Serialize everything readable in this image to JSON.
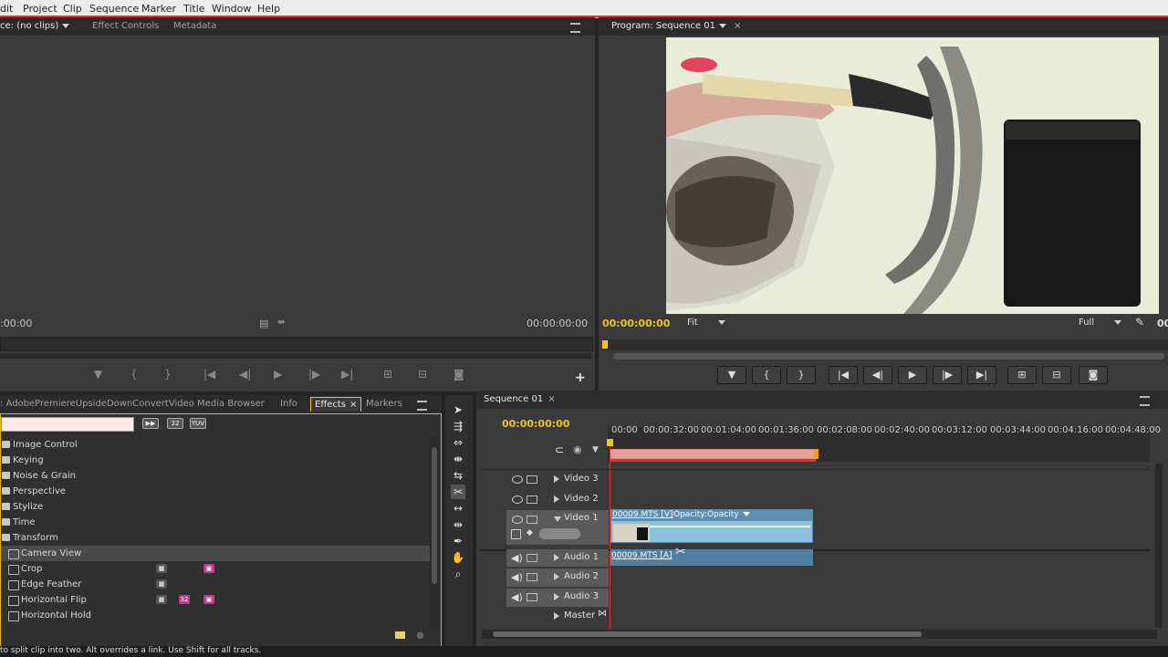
{
  "menu": [
    "dit",
    "Project",
    "Clip",
    "Sequence",
    "Marker",
    "Title",
    "Window",
    "Help"
  ],
  "source_panel": {
    "tabs": [
      "ce: (no clips)",
      "Effect Controls",
      "Metadata"
    ],
    "tc_left": ":00:00",
    "tc_right": "00:00:00:00"
  },
  "program_panel": {
    "tab": "Program: Sequence 01",
    "tc": "00:00:00:00",
    "fit": "Fit",
    "quality": "Full",
    "tc_right_partial": "00"
  },
  "project_panel": {
    "tabs": [
      ": AdobePremiereUpsideDownConvertVideo",
      "Media Browser",
      "Info",
      "Effects",
      "Markers"
    ],
    "badges": [
      "32",
      "YUV"
    ],
    "effects": [
      {
        "label": "Image Control",
        "type": "folder"
      },
      {
        "label": "Keying",
        "type": "folder"
      },
      {
        "label": "Noise & Grain",
        "type": "folder"
      },
      {
        "label": "Perspective",
        "type": "folder"
      },
      {
        "label": "Stylize",
        "type": "folder"
      },
      {
        "label": "Time",
        "type": "folder"
      },
      {
        "label": "Transform",
        "type": "folder"
      },
      {
        "label": "Camera View",
        "type": "effect"
      },
      {
        "label": "Crop",
        "type": "effect"
      },
      {
        "label": "Edge Feather",
        "type": "effect"
      },
      {
        "label": "Horizontal Flip",
        "type": "effect"
      },
      {
        "label": "Horizontal Hold",
        "type": "effect"
      }
    ]
  },
  "timeline": {
    "tab": "Sequence 01",
    "tc": "00:00:00:00",
    "ruler": [
      "00:00",
      "00:00:32:00",
      "00:01:04:00",
      "00:01:36:00",
      "00:02:08:00",
      "00:02:40:00",
      "00:03:12:00",
      "00:03:44:00",
      "00:04:16:00",
      "00:04:48:00"
    ],
    "tracks": [
      "Video 3",
      "Video 2",
      "Video 1",
      "Audio 1",
      "Audio 2",
      "Audio 3",
      "Master"
    ],
    "video_clip": "00009.MTS [V]",
    "opacity_label": "Opacity:Opacity",
    "audio_clip": "00009.MTS [A]"
  },
  "status_text": "to split clip into two. Alt overrides a link. Use Shift for all tracks.",
  "colors": {
    "accent_timecode": "#f0c419",
    "playhead": "#e52f2f",
    "video_clip": "#7aa9c8",
    "audio_clip": "#4f7fa3"
  }
}
